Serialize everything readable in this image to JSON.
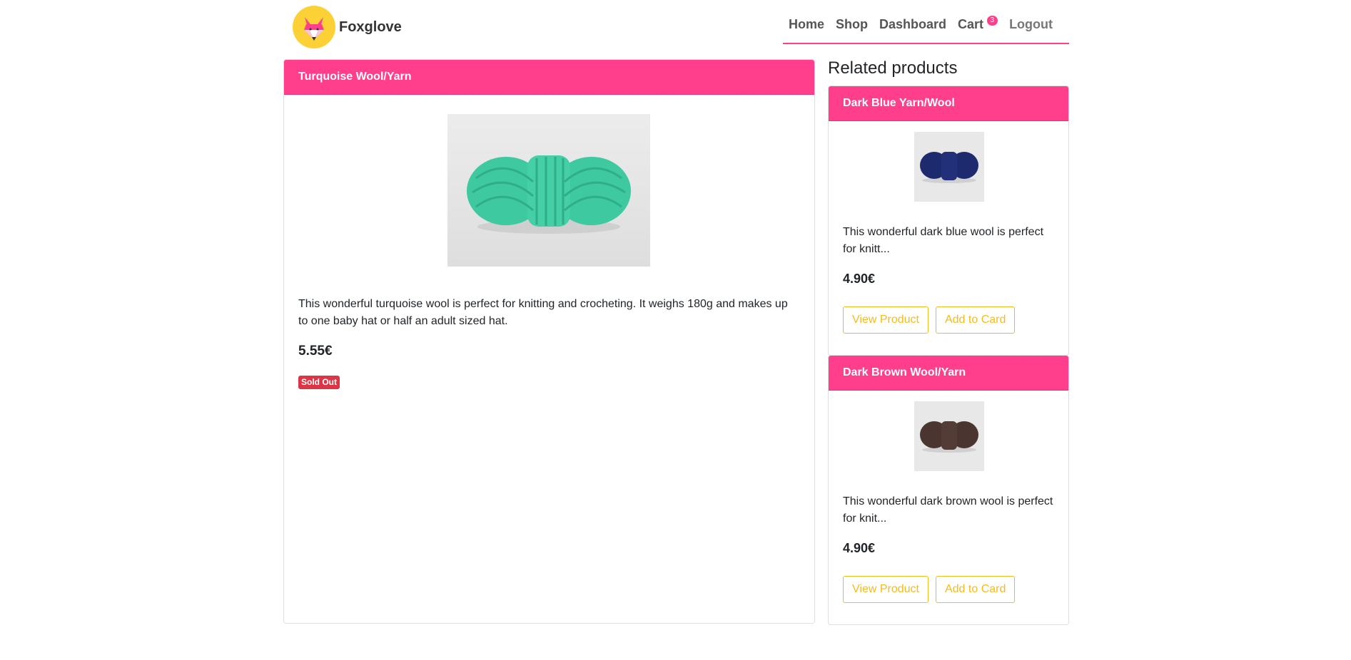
{
  "brand": {
    "name": "Foxglove",
    "logo": "fox-logo-icon"
  },
  "nav": {
    "home": "Home",
    "shop": "Shop",
    "dashboard": "Dashboard",
    "cart": "Cart",
    "cart_count": "3",
    "logout": "Logout"
  },
  "product": {
    "title": "Turquoise Wool/Yarn",
    "image": "turquoise-yarn-skein",
    "description": "This wonderful turquoise wool is perfect for knitting and crocheting. It weighs 180g and makes up to one baby hat or half an adult sized hat.",
    "price": "5.55€",
    "status": "Sold Out"
  },
  "related": {
    "title": "Related products",
    "items": [
      {
        "title": "Dark Blue Yarn/Wool",
        "image": "dark-blue-yarn-skein",
        "description": "This wonderful dark blue wool is perfect for knitt...",
        "price": "4.90€",
        "view_label": "View Product",
        "add_label": "Add to Card"
      },
      {
        "title": "Dark Brown Wool/Yarn",
        "image": "dark-brown-yarn-skein",
        "description": "This wonderful dark brown wool is perfect for knit...",
        "price": "4.90€",
        "view_label": "View Product",
        "add_label": "Add to Card"
      }
    ]
  },
  "colors": {
    "accent": "#ff3e8c",
    "button_outline": "#f3bc1d",
    "sold_out": "#dc3545",
    "logo_bg": "#fbd135",
    "yarn_turquoise": "#3ec9a0",
    "yarn_blue": "#1e2a6e",
    "yarn_brown": "#4a3530"
  }
}
